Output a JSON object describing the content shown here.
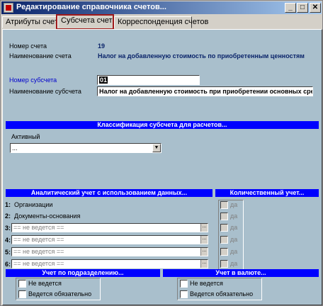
{
  "window": {
    "title": "Редактирование справочника счетов...",
    "minimize": "_",
    "maximize": "□",
    "close": "✕"
  },
  "tabs": [
    {
      "label": "Атрибуты счета"
    },
    {
      "label": "Субсчета счета"
    },
    {
      "label": "Корреспонденция счетов"
    }
  ],
  "account": {
    "number_label": "Номер счета",
    "number_value": "19",
    "name_label": "Наименование счета",
    "name_value": "Налог на добавленную стоимость по приобретенным ценностям"
  },
  "subaccount": {
    "number_label": "Номер субсчета",
    "number_value": "01",
    "name_label": "Наименование субсчета",
    "name_value": "Налог на добавленную стоимость при приобретении основных сре"
  },
  "classification": {
    "header": "Классификация субсчета для расчетов...",
    "type_label": "Активный",
    "type_value": "...",
    "dropdown_icon": "chevron-down-icon"
  },
  "analytics": {
    "header": "Аналитический учет с использованием данных...",
    "rows": [
      {
        "num": "1:",
        "label": "Организации"
      },
      {
        "num": "2:",
        "label": "Документы-основания"
      },
      {
        "num": "3:",
        "value": "== не ведется =="
      },
      {
        "num": "4:",
        "value": "== не ведется =="
      },
      {
        "num": "5:",
        "value": "== не ведется =="
      },
      {
        "num": "6:",
        "value": "== не ведется =="
      }
    ],
    "dots": "..."
  },
  "quantity": {
    "header": "Количественный учет...",
    "check_label": "да"
  },
  "division": {
    "header": "Учет по подразделению...",
    "opt1": "Не ведется",
    "opt2": "Ведется обязательно"
  },
  "currency": {
    "header": "Учет в валюте...",
    "opt1": "Не ведется",
    "opt2": "Ведется обязательно"
  }
}
